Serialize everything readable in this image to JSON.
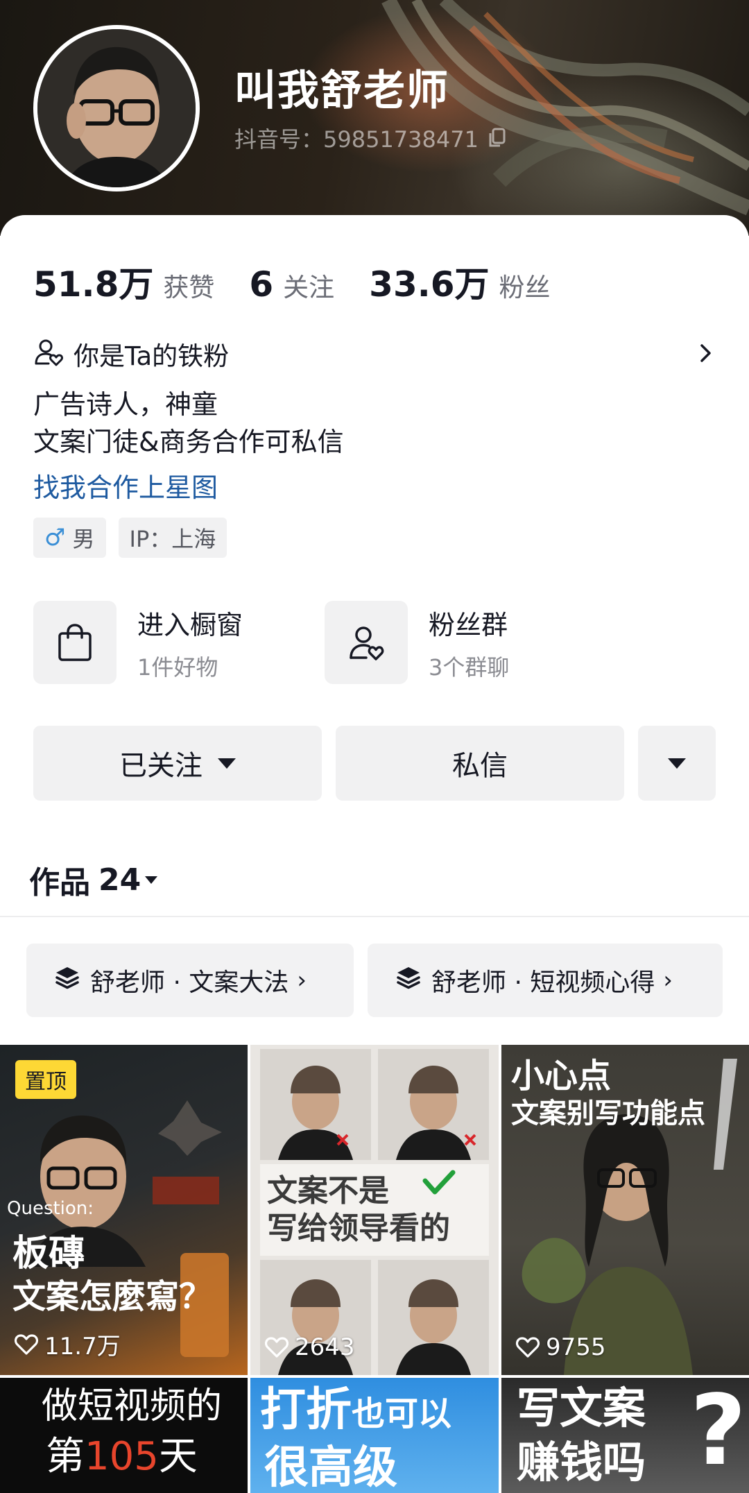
{
  "profile": {
    "nickname": "叫我舒老师",
    "douyin_id": "抖音号：59851738471"
  },
  "stats": [
    {
      "num": "51.8万",
      "label": "获赞"
    },
    {
      "num": "6",
      "label": "关注"
    },
    {
      "num": "33.6万",
      "label": "粉丝"
    }
  ],
  "fan_status": "你是Ta的铁粉",
  "bio": {
    "line1": "广告诗人，神童",
    "line2": "文案门徒&商务合作可私信",
    "link": "找我合作上星图"
  },
  "tags": {
    "gender": "男",
    "ip": "IP：上海"
  },
  "entries": [
    {
      "title": "进入橱窗",
      "sub": "1件好物",
      "icon": "shopping-bag-icon"
    },
    {
      "title": "粉丝群",
      "sub": "3个群聊",
      "icon": "fan-group-icon"
    }
  ],
  "actions": {
    "followed": "已关注",
    "message": "私信"
  },
  "works": {
    "label": "作品",
    "count": "24"
  },
  "collections": [
    {
      "label": "舒老师 · 文案大法"
    },
    {
      "label": "舒老师 · 短视频心得"
    }
  ],
  "videos": [
    {
      "pin": "置顶",
      "question": "Question:",
      "title1": "板磚",
      "title2": "文案怎麼寫？",
      "likes": "11.7万"
    },
    {
      "big1": "文案不是",
      "big2": "写给领导看的",
      "likes": "2643"
    },
    {
      "title1": "小心点",
      "title2": "文案别写功能点",
      "likes": "9755"
    },
    {
      "line1": "做短视频的",
      "line2a": "第",
      "line2b": "105",
      "line2c": "天"
    },
    {
      "line1": "打折",
      "line1b": "也可以",
      "line2": "很高级"
    },
    {
      "line1": "写文案",
      "line2": "赚钱吗"
    }
  ],
  "colors": {
    "link": "#1e5aa0",
    "pin_badge": "#fdd835",
    "button_bg": "#f1f1f2",
    "accent_red": "#e8452c"
  }
}
